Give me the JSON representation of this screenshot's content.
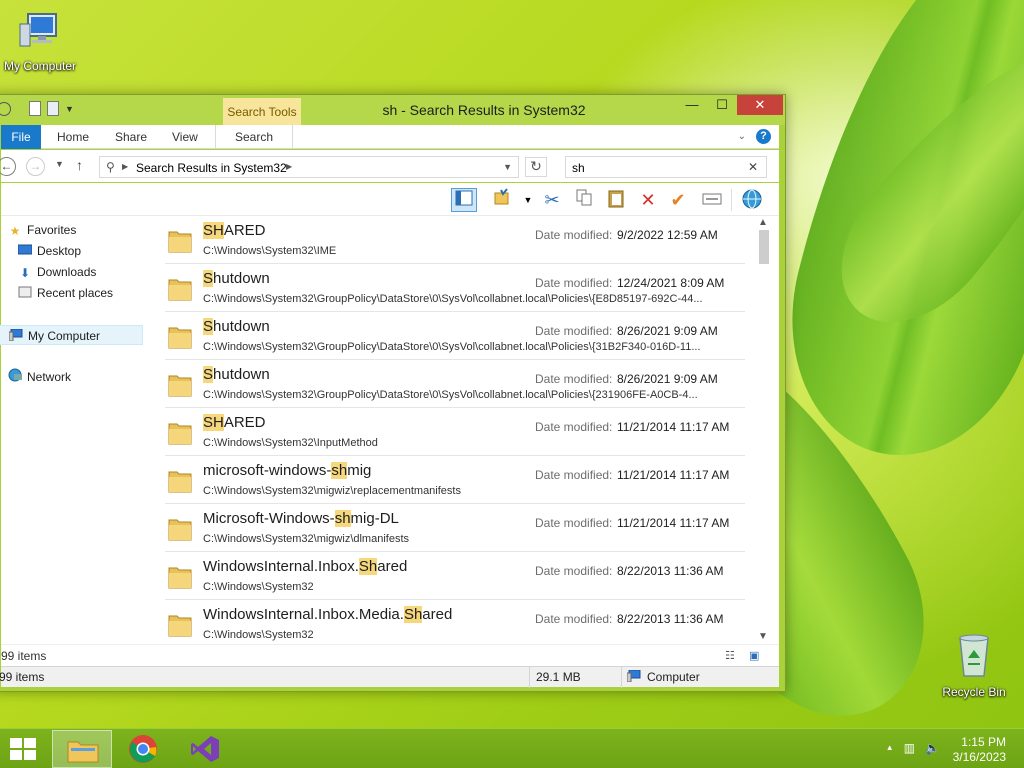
{
  "desktop": {
    "my_computer_label": "My Computer",
    "recycle_bin_label": "Recycle Bin"
  },
  "window": {
    "title": "sh - Search Results in System32",
    "search_tools_label": "Search Tools",
    "controls": {
      "minimize": "—",
      "maximize": "☐",
      "close": "✕"
    }
  },
  "ribbon": {
    "tabs": {
      "file": "File",
      "home": "Home",
      "share": "Share",
      "view": "View",
      "search": "Search"
    },
    "help": "?"
  },
  "address_bar": {
    "path": "Search Results in System32",
    "search_value": "sh"
  },
  "nav_pane": {
    "favorites": "Favorites",
    "desktop": "Desktop",
    "downloads": "Downloads",
    "recent_places": "Recent places",
    "my_computer": "My Computer",
    "network": "Network"
  },
  "results": {
    "date_label": "Date modified:",
    "items": [
      {
        "pre": "",
        "hl": "SH",
        "post": "ARED",
        "path": "C:\\Windows\\System32\\IME",
        "date": "9/2/2022 12:59 AM"
      },
      {
        "pre": "",
        "hl": "S",
        "post": "hutdown",
        "path": "C:\\Windows\\System32\\GroupPolicy\\DataStore\\0\\SysVol\\collabnet.local\\Policies\\{E8D85197-692C-44...",
        "date": "12/24/2021 8:09 AM"
      },
      {
        "pre": "",
        "hl": "S",
        "post": "hutdown",
        "path": "C:\\Windows\\System32\\GroupPolicy\\DataStore\\0\\SysVol\\collabnet.local\\Policies\\{31B2F340-016D-11...",
        "date": "8/26/2021 9:09 AM"
      },
      {
        "pre": "",
        "hl": "S",
        "post": "hutdown",
        "path": "C:\\Windows\\System32\\GroupPolicy\\DataStore\\0\\SysVol\\collabnet.local\\Policies\\{231906FE-A0CB-4...",
        "date": "8/26/2021 9:09 AM"
      },
      {
        "pre": "",
        "hl": "SH",
        "post": "ARED",
        "path": "C:\\Windows\\System32\\InputMethod",
        "date": "11/21/2014 11:17 AM"
      },
      {
        "pre": "microsoft-windows-",
        "hl": "sh",
        "post": "mig",
        "path": "C:\\Windows\\System32\\migwiz\\replacementmanifests",
        "date": "11/21/2014 11:17 AM"
      },
      {
        "pre": "Microsoft-Windows-",
        "hl": "sh",
        "post": "mig-DL",
        "path": "C:\\Windows\\System32\\migwiz\\dlmanifests",
        "date": "11/21/2014 11:17 AM"
      },
      {
        "pre": "WindowsInternal.Inbox.",
        "hl": "Sh",
        "post": "ared",
        "path": "C:\\Windows\\System32",
        "date": "8/22/2013 11:36 AM"
      },
      {
        "pre": "WindowsInternal.Inbox.Media.",
        "hl": "Sh",
        "post": "ared",
        "path": "C:\\Windows\\System32",
        "date": "8/22/2013 11:36 AM"
      }
    ]
  },
  "status": {
    "panel_count": "99 items",
    "bar_count": "99 items",
    "size": "29.1 MB",
    "location": "Computer"
  },
  "taskbar": {
    "time": "1:15 PM",
    "date": "3/16/2023",
    "tray_arrow": "▲"
  },
  "colors": {
    "accent": "#1979ca",
    "highlight": "#f6d77b",
    "window_frame": "#b5d84a",
    "close_button": "#c7423a"
  }
}
